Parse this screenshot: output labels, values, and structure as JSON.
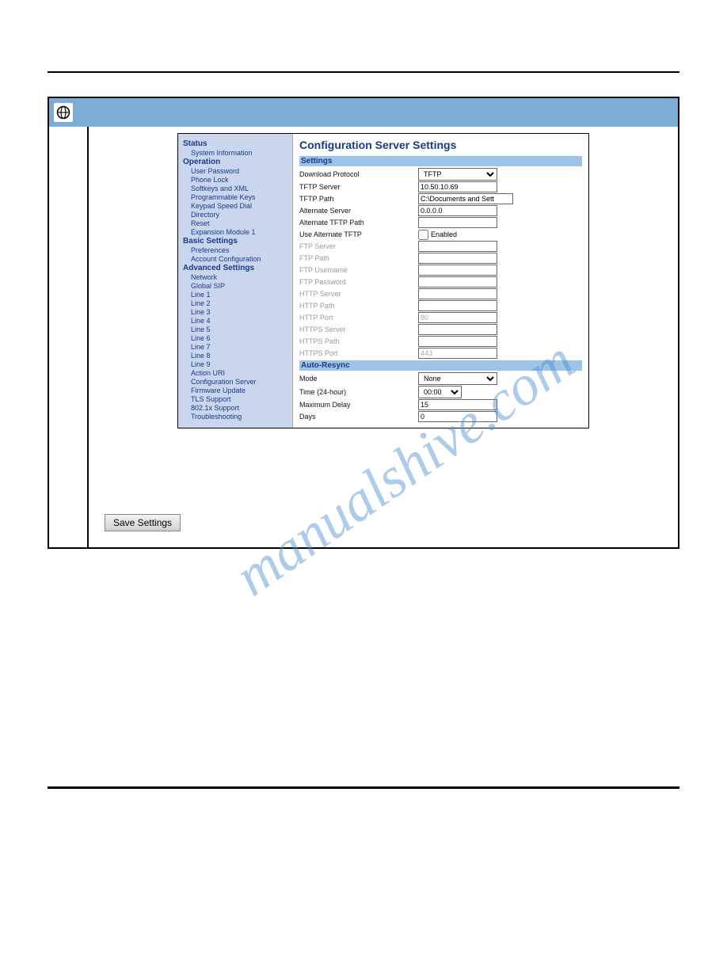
{
  "watermark": "manualshive.com",
  "ui": {
    "sidebar": {
      "status": {
        "header": "Status",
        "items": [
          "System Information"
        ]
      },
      "operation": {
        "header": "Operation",
        "items": [
          "User Password",
          "Phone Lock",
          "Softkeys and XML",
          "Programmable Keys",
          "Keypad Speed Dial",
          "Directory",
          "Reset",
          "Expansion Module 1"
        ]
      },
      "basic": {
        "header": "Basic Settings",
        "items": [
          "Preferences",
          "Account Configuration"
        ]
      },
      "advanced": {
        "header": "Advanced Settings",
        "items": [
          "Network",
          "Global SIP",
          "Line 1",
          "Line 2",
          "Line 3",
          "Line 4",
          "Line 5",
          "Line 6",
          "Line 7",
          "Line 8",
          "Line 9",
          "Action URI",
          "Configuration Server",
          "Firmware Update",
          "TLS Support",
          "802.1x Support",
          "Troubleshooting"
        ]
      }
    },
    "title": "Configuration Server Settings",
    "sections": {
      "settings": {
        "header": "Settings"
      },
      "autoresync": {
        "header": "Auto-Resync"
      }
    },
    "fields": {
      "download_protocol": {
        "label": "Download Protocol",
        "value": "TFTP"
      },
      "tftp_server": {
        "label": "TFTP Server",
        "value": "10.50.10.69"
      },
      "tftp_path": {
        "label": "TFTP Path",
        "value": "C:\\Documents and Sett"
      },
      "alternate_server": {
        "label": "Alternate Server",
        "value": "0.0.0.0"
      },
      "alternate_tftp_path": {
        "label": "Alternate TFTP Path",
        "value": ""
      },
      "use_alternate_tftp": {
        "label": "Use Alternate TFTP",
        "checkbox_label": "Enabled"
      },
      "ftp_server": {
        "label": "FTP Server",
        "value": ""
      },
      "ftp_path": {
        "label": "FTP Path",
        "value": ""
      },
      "ftp_username": {
        "label": "FTP Username",
        "value": ""
      },
      "ftp_password": {
        "label": "FTP Password",
        "value": ""
      },
      "http_server": {
        "label": "HTTP Server",
        "value": ""
      },
      "http_path": {
        "label": "HTTP Path",
        "value": ""
      },
      "http_port": {
        "label": "HTTP Port",
        "value": "80"
      },
      "https_server": {
        "label": "HTTPS Server",
        "value": ""
      },
      "https_path": {
        "label": "HTTPS Path",
        "value": ""
      },
      "https_port": {
        "label": "HTTPS Port",
        "value": "443"
      },
      "mode": {
        "label": "Mode",
        "value": "None"
      },
      "time": {
        "label": "Time (24-hour)",
        "value": "00:00"
      },
      "max_delay": {
        "label": "Maximum Delay",
        "value": "15"
      },
      "days": {
        "label": "Days",
        "value": "0"
      }
    }
  },
  "save_button": "Save Settings"
}
